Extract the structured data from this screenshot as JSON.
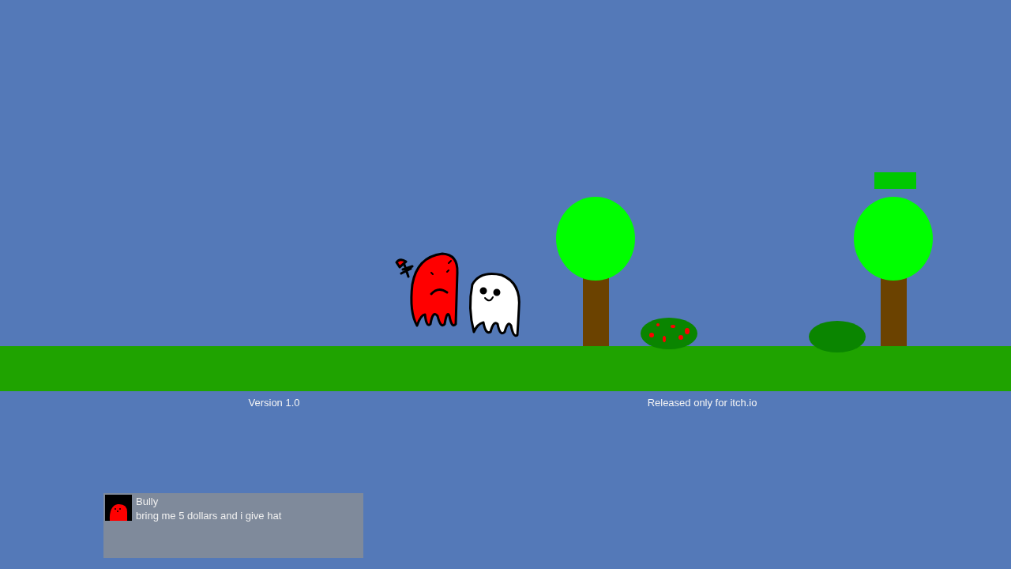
{
  "footer": {
    "version": "Version 1.0",
    "release_note": "Released only for itch.io"
  },
  "dialog": {
    "speaker": "Bully",
    "message": "bring me 5 dollars and i give hat"
  }
}
